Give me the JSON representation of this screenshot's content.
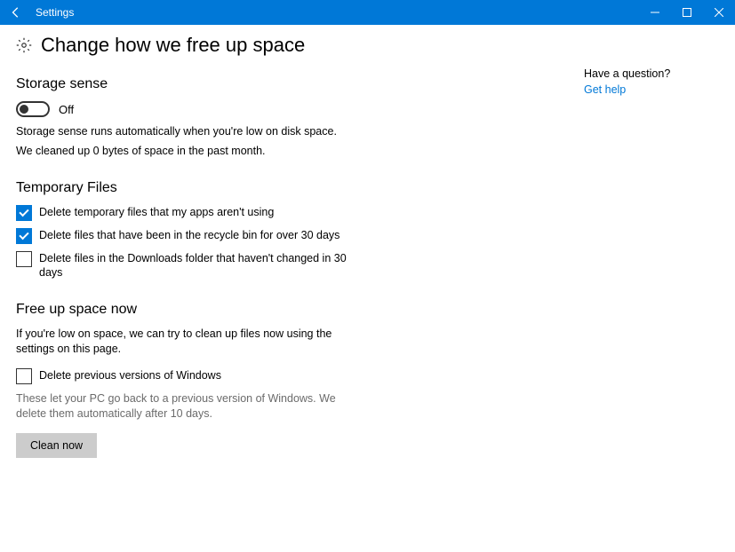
{
  "titlebar": {
    "title": "Settings"
  },
  "page": {
    "title": "Change how we free up space"
  },
  "storage_sense": {
    "heading": "Storage sense",
    "toggle_state": "Off",
    "desc_line1": "Storage sense runs automatically when you're low on disk space.",
    "desc_line2": "We cleaned up 0 bytes of space in the past month."
  },
  "temp_files": {
    "heading": "Temporary Files",
    "items": [
      {
        "label": "Delete temporary files that my apps aren't using",
        "checked": true
      },
      {
        "label": "Delete files that have been in the recycle bin for over 30 days",
        "checked": true
      },
      {
        "label": "Delete files in the Downloads folder that haven't changed in 30 days",
        "checked": false
      }
    ]
  },
  "free_up": {
    "heading": "Free up space now",
    "desc": "If you're low on space, we can try to clean up files now using the settings on this page.",
    "prev_versions_label": "Delete previous versions of Windows",
    "prev_versions_checked": false,
    "prev_versions_note": "These let your PC go back to a previous version of Windows. We delete them automatically after 10 days.",
    "button": "Clean now"
  },
  "side": {
    "question": "Have a question?",
    "link": "Get help"
  }
}
